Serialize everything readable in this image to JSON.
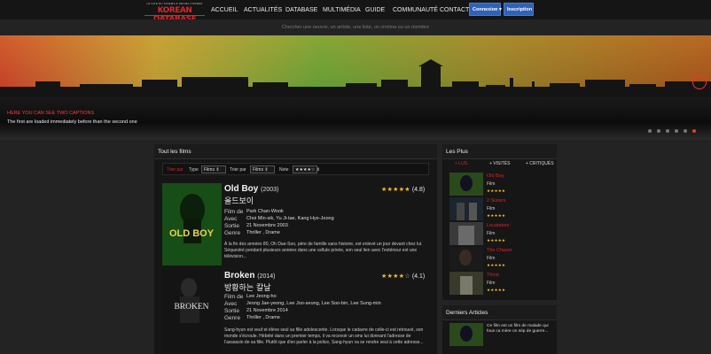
{
  "logo": {
    "tagline": "LE SITE DU CINEMA & DRAMA CORÉEN",
    "name": "KOREAN DATABASE"
  },
  "nav": {
    "items": [
      "ACCUEIL",
      "ACTUALITÉS",
      "DATABASE",
      "MULTIMÉDIA",
      "GUIDE",
      "COMMUNAUTÉ",
      "CONTACT"
    ],
    "connexion": "Connexion ▾",
    "inscription": "Inscription"
  },
  "search": {
    "placeholder": "Chercher une oeuvre, un artiste, une liste, un cinéma ou un membre"
  },
  "banner": {
    "caption_title": "HERE YOU CAN SEE TWO CAPTIONS",
    "caption_text": "The first are loaded immediately before than the second one",
    "slide_count": 6,
    "active_slide": 6
  },
  "films_panel": {
    "title": "Tout les films",
    "filters": {
      "trier_label": "Trier par",
      "type_label": "Type",
      "type_value": "Films",
      "trier_par_label": "Trier par",
      "trier_par_value": "Films",
      "note_label": "Note",
      "note_value": "★★★★☆"
    },
    "field_labels": {
      "director": "Film de",
      "cast": "Avec",
      "release": "Sortie",
      "genre": "Genre"
    },
    "films": [
      {
        "title": "Old Boy",
        "year": "(2003)",
        "korean_title": "올드보이",
        "stars": "★★★★★",
        "stars_empty": "",
        "rating": "(4.8)",
        "director": "Park Chan-Wook",
        "cast": "Choi Min-sik, Yu Ji-tae, Kang Hye-Jeong",
        "release": "21 Novembre 2003",
        "genre": "Thriller , Drame",
        "description": "À la fin des années 80, Oh Dae-Soo, père de famille sans histoire, est enlevé un jour devant chez lui. Séquestré pendant plusieurs années dans une cellule privée, son seul lien avec l'extérieur est une télévision..."
      },
      {
        "title": "Broken",
        "year": "(2014)",
        "korean_title": "방황하는 칼날",
        "stars": "★★★★",
        "stars_empty": "☆",
        "rating": "(4.1)",
        "director": "Lee Jeong-ho",
        "cast": "Jeong Jae-yeong, Lee Joo-seung, Lee Soo-bin, Lee Sung-min",
        "release": "21 Novembre 2014",
        "genre": "Thriller , Drame",
        "description": "Sang-hyun est veuf et élève seul sa fille adolescente. Lorsque le cadavre de celle-ci est retrouvé, son monde s'écroule. Hébété dans un premier temps, il va recevoir un sms lui donnant l'adresse de l'assassin de sa fille. Plutôt que d'en parler à la police, Sang-hyun va se rendre seul à cette adresse..."
      }
    ],
    "posters": [
      {
        "text": "OLD BOY",
        "color": "#e9d24a"
      },
      {
        "text": "BROKEN",
        "color": "#e8e8e8"
      }
    ]
  },
  "plus_panel": {
    "title": "Les Plus",
    "tabs": [
      "+ LUS",
      "+ VISITÉS",
      "+ CRITIQUÉS"
    ],
    "items": [
      {
        "title": "Old Boy",
        "kind": "Film",
        "stars": "★★★★★"
      },
      {
        "title": "2 Sisters",
        "kind": "Film",
        "stars": "★★★★★"
      },
      {
        "title": "Locataires",
        "kind": "Film",
        "stars": "★★★★★"
      },
      {
        "title": "The Chaser",
        "kind": "Film",
        "stars": "★★★★★"
      },
      {
        "title": "Thirst",
        "kind": "Film",
        "stars": "★★★★★"
      }
    ]
  },
  "articles_panel": {
    "title": "Derniers Articles",
    "article_text": "Ce film est un film de malade qui fous ca mère on sép de guerre..."
  },
  "colors": {
    "accent_red": "#d8262b",
    "button_blue": "#2f62b8",
    "star_gold": "#f2c01e"
  }
}
